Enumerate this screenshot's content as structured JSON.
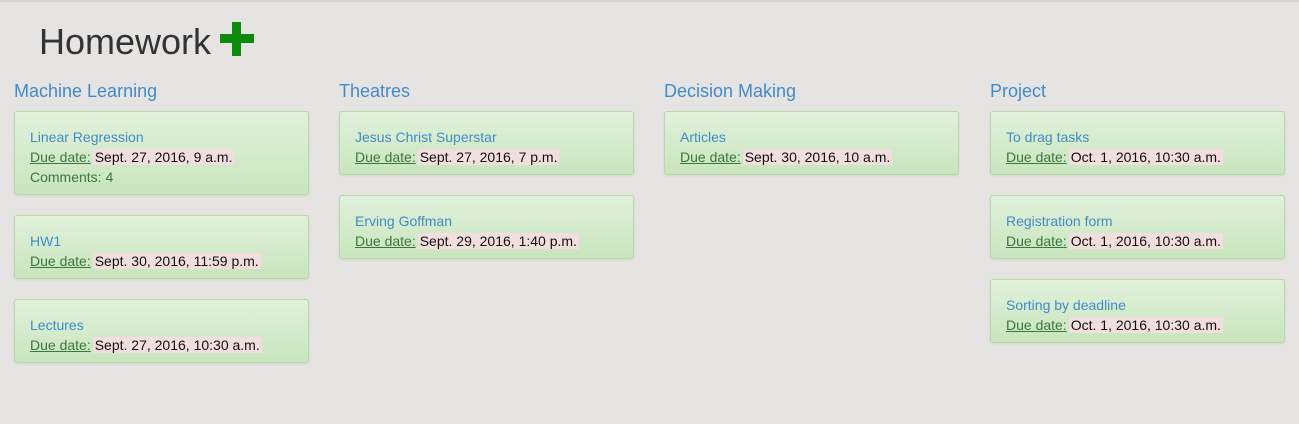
{
  "page": {
    "title": "Homework",
    "add_icon": "plus-icon",
    "accent_color": "#0c8a0c"
  },
  "columns": [
    {
      "title": "Machine Learning",
      "cards": [
        {
          "name": "Linear Regression",
          "due_label": "Due date:",
          "due": "Sept. 27, 2016, 9 a.m.",
          "comments": "Comments: 4"
        },
        {
          "name": "HW1",
          "due_label": "Due date:",
          "due": "Sept. 30, 2016, 11:59 p.m."
        },
        {
          "name": "Lectures",
          "due_label": "Due date:",
          "due": "Sept. 27, 2016, 10:30 a.m."
        }
      ]
    },
    {
      "title": "Theatres",
      "cards": [
        {
          "name": "Jesus Christ Superstar",
          "due_label": "Due date:",
          "due": "Sept. 27, 2016, 7 p.m."
        },
        {
          "name": "Erving Goffman",
          "due_label": "Due date:",
          "due": "Sept. 29, 2016, 1:40 p.m."
        }
      ]
    },
    {
      "title": "Decision Making",
      "cards": [
        {
          "name": "Articles",
          "due_label": "Due date:",
          "due": "Sept. 30, 2016, 10 a.m."
        }
      ]
    },
    {
      "title": "Project",
      "cards": [
        {
          "name": "To drag tasks",
          "due_label": "Due date:",
          "due": "Oct. 1, 2016, 10:30 a.m."
        },
        {
          "name": "Registration form",
          "due_label": "Due date:",
          "due": "Oct. 1, 2016, 10:30 a.m."
        },
        {
          "name": "Sorting by deadline",
          "due_label": "Due date:",
          "due": "Oct. 1, 2016, 10:30 a.m."
        }
      ]
    }
  ]
}
